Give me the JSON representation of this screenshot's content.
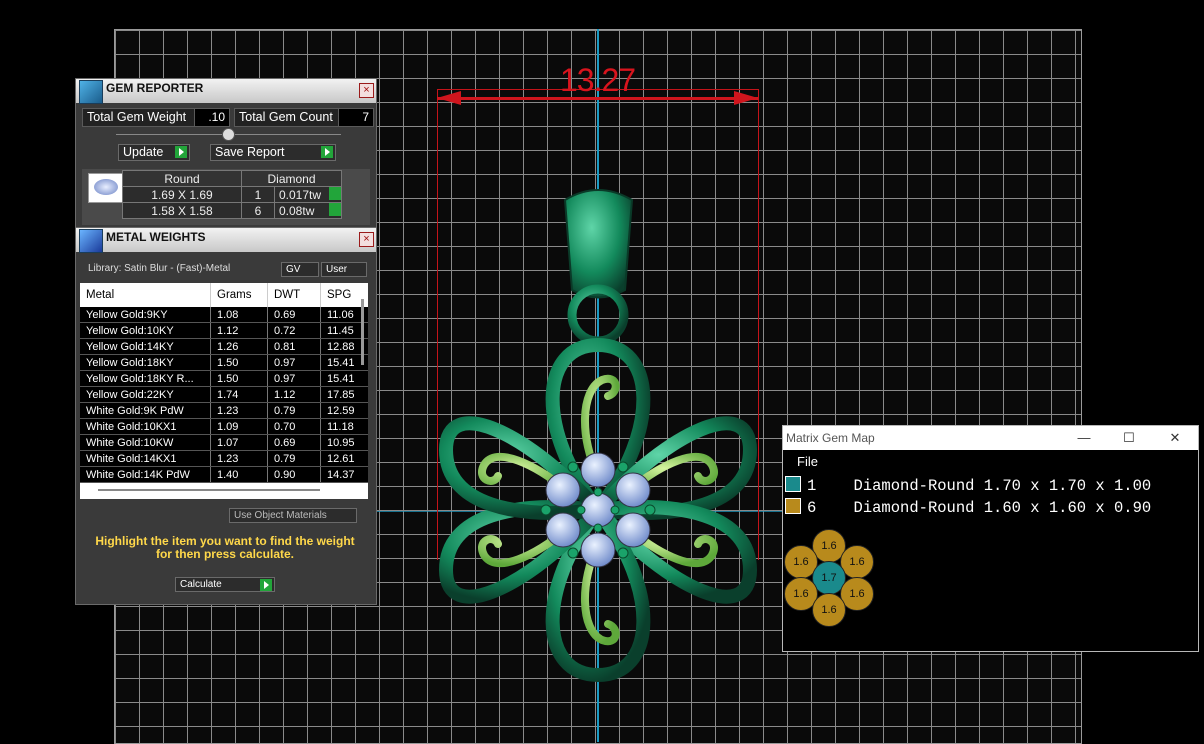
{
  "viewport": {
    "dimension_value": "13.27"
  },
  "gem_reporter": {
    "title": "GEM REPORTER",
    "total_gem_weight_label": "Total Gem Weight",
    "total_gem_weight_value": ".10",
    "total_gem_count_label": "Total Gem Count",
    "total_gem_count_value": "7",
    "update_label": "Update",
    "save_report_label": "Save Report",
    "shape_header": "Round",
    "material_header": "Diamond",
    "rows": [
      {
        "size": "1.69 X 1.69",
        "count": "1",
        "weight": "0.017tw"
      },
      {
        "size": "1.58 X 1.58",
        "count": "6",
        "weight": "0.08tw"
      }
    ]
  },
  "metal_weights": {
    "title": "METAL WEIGHTS",
    "library": "Library: Satin Blur - (Fast)-Metal",
    "gv_label": "GV",
    "user_label": "User",
    "columns": [
      "Metal",
      "Grams",
      "DWT",
      "SPG"
    ],
    "rows": [
      [
        "Yellow Gold:9KY",
        "1.08",
        "0.69",
        "11.06"
      ],
      [
        "Yellow Gold:10KY",
        "1.12",
        "0.72",
        "11.45"
      ],
      [
        "Yellow Gold:14KY",
        "1.26",
        "0.81",
        "12.88"
      ],
      [
        "Yellow Gold:18KY",
        "1.50",
        "0.97",
        "15.41"
      ],
      [
        "Yellow Gold:18KY R...",
        "1.50",
        "0.97",
        "15.41"
      ],
      [
        "Yellow Gold:22KY",
        "1.74",
        "1.12",
        "17.85"
      ],
      [
        "White Gold:9K PdW",
        "1.23",
        "0.79",
        "12.59"
      ],
      [
        "White Gold:10KX1",
        "1.09",
        "0.70",
        "11.18"
      ],
      [
        "White Gold:10KW",
        "1.07",
        "0.69",
        "10.95"
      ],
      [
        "White Gold:14KX1",
        "1.23",
        "0.79",
        "12.61"
      ],
      [
        "White Gold:14K PdW",
        "1.40",
        "0.90",
        "14.37"
      ]
    ],
    "use_object_materials": "Use Object Materials",
    "instruction": "Highlight the item you want to find the weight for then press calculate.",
    "calculate_label": "Calculate"
  },
  "gem_map": {
    "title": "Matrix Gem Map",
    "menu_file": "File",
    "entries": [
      {
        "count": "1",
        "desc": "Diamond-Round 1.70 x 1.70 x 1.00",
        "color": "#1a8a8c"
      },
      {
        "count": "6",
        "desc": "Diamond-Round 1.60 x 1.60 x 0.90",
        "color": "#b88a1c"
      }
    ],
    "dots": [
      "1.6",
      "1.6",
      "1.6",
      "1.7",
      "1.6",
      "1.6",
      "1.6"
    ]
  }
}
